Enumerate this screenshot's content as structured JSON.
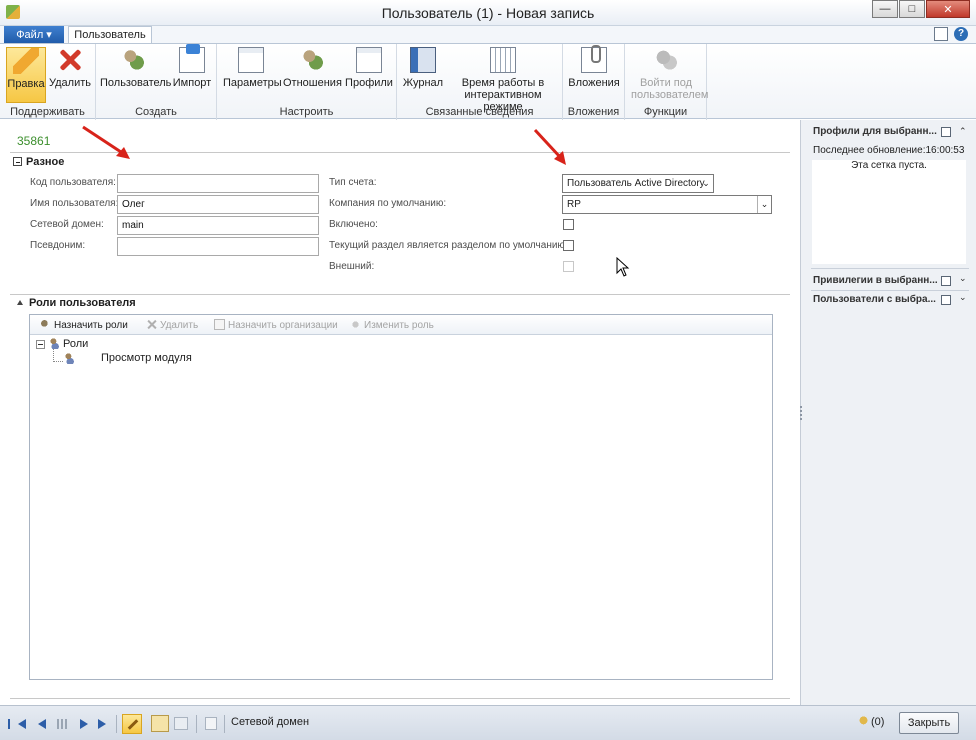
{
  "window": {
    "title": "Пользователь (1) - Новая запись",
    "controls": [
      "minimize-icon",
      "maximize-icon",
      "close-icon"
    ]
  },
  "tabs": {
    "file": "Файл",
    "user": "Пользователь"
  },
  "ribbon": {
    "groups": [
      {
        "label": "Поддерживать",
        "buttons": [
          {
            "label": "Правка",
            "icon": "pencil-icon",
            "active": true
          },
          {
            "label": "Удалить",
            "icon": "delete-x-icon"
          }
        ]
      },
      {
        "label": "Создать",
        "buttons": [
          {
            "label": "Пользователь",
            "icon": "new-user-icon"
          },
          {
            "label": "Импорт",
            "icon": "import-icon"
          }
        ]
      },
      {
        "label": "Настроить",
        "buttons": [
          {
            "label": "Параметры",
            "icon": "options-doc-icon"
          },
          {
            "label": "Отношения",
            "icon": "relations-icon"
          },
          {
            "label": "Профили",
            "icon": "profiles-icon"
          }
        ]
      },
      {
        "label": "Связанные сведения",
        "buttons": [
          {
            "label": "Журнал",
            "icon": "log-book-icon"
          },
          {
            "label": "Время работы в интерактивном режиме",
            "icon": "online-time-grid-icon"
          }
        ]
      },
      {
        "label": "Вложения",
        "buttons": [
          {
            "label": "Вложения",
            "icon": "attachment-icon"
          }
        ]
      },
      {
        "label": "Функции",
        "buttons": [
          {
            "label": "Войти под пользователем",
            "icon": "run-as-user-icon",
            "disabled": true
          }
        ]
      }
    ]
  },
  "record": {
    "id": "35861"
  },
  "section_misc": {
    "title": "Разное",
    "fields": {
      "user_id": {
        "label": "Код пользователя:",
        "value": ""
      },
      "user_name": {
        "label": "Имя пользователя:",
        "value": "Олег"
      },
      "network_domain": {
        "label": "Сетевой домен:",
        "value": "main"
      },
      "alias": {
        "label": "Псевдоним:",
        "value": ""
      },
      "account_type": {
        "label": "Тип счета:",
        "value": "Пользователь Active Directory"
      },
      "default_company": {
        "label": "Компания по умолчанию:",
        "value": "RP"
      },
      "enabled": {
        "label": "Включено:",
        "checked": false
      },
      "default_partition": {
        "label": "Текущий раздел является разделом по умолчанию:",
        "checked": false
      },
      "external": {
        "label": "Внешний:",
        "checked": false,
        "disabled": true
      }
    }
  },
  "section_roles": {
    "title": "Роли пользователя",
    "toolbar": {
      "assign_roles": "Назначить роли",
      "delete": "Удалить",
      "assign_orgs": "Назначить организации",
      "change_role": "Изменить роль"
    },
    "tree": {
      "root": "Роли",
      "children": [
        "Просмотр модуля"
      ]
    }
  },
  "factboxes": {
    "profiles": {
      "title": "Профили для выбранн...",
      "last_updated": "Последнее обновление:16:00:53",
      "empty_text": "Эта сетка пуста."
    },
    "privileges": {
      "title": "Привилегии в выбранн..."
    },
    "users": {
      "title": "Пользователи с выбра..."
    }
  },
  "statusbar": {
    "field_help": "Сетевой домен",
    "notifications": "(0)",
    "close": "Закрыть"
  },
  "colors": {
    "accent_red": "#d8231a",
    "record_id_green": "#3c8f2d",
    "file_tab": "#2b67b5"
  }
}
